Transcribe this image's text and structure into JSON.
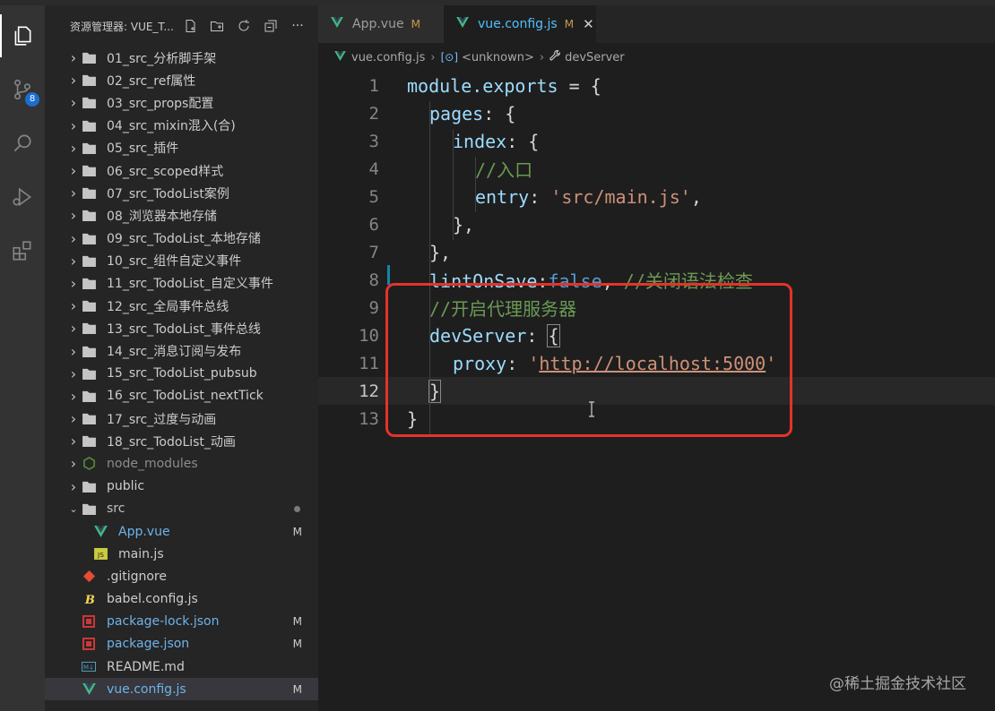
{
  "sidebar": {
    "title": "资源管理器: VUE_T...",
    "items": [
      {
        "name": "01_src_分析脚手架",
        "type": "folder",
        "expanded": false,
        "depth": 0
      },
      {
        "name": "02_src_ref属性",
        "type": "folder",
        "expanded": false,
        "depth": 0
      },
      {
        "name": "03_src_props配置",
        "type": "folder",
        "expanded": false,
        "depth": 0
      },
      {
        "name": "04_src_mixin混入(合)",
        "type": "folder",
        "expanded": false,
        "depth": 0
      },
      {
        "name": "05_src_插件",
        "type": "folder",
        "expanded": false,
        "depth": 0
      },
      {
        "name": "06_src_scoped样式",
        "type": "folder",
        "expanded": false,
        "depth": 0
      },
      {
        "name": "07_src_TodoList案例",
        "type": "folder",
        "expanded": false,
        "depth": 0
      },
      {
        "name": "08_浏览器本地存储",
        "type": "folder",
        "expanded": false,
        "depth": 0
      },
      {
        "name": "09_src_TodoList_本地存储",
        "type": "folder",
        "expanded": false,
        "depth": 0
      },
      {
        "name": "10_src_组件自定义事件",
        "type": "folder",
        "expanded": false,
        "depth": 0
      },
      {
        "name": "11_src_TodoList_自定义事件",
        "type": "folder",
        "expanded": false,
        "depth": 0
      },
      {
        "name": "12_src_全局事件总线",
        "type": "folder",
        "expanded": false,
        "depth": 0
      },
      {
        "name": "13_src_TodoList_事件总线",
        "type": "folder",
        "expanded": false,
        "depth": 0
      },
      {
        "name": "14_src_消息订阅与发布",
        "type": "folder",
        "expanded": false,
        "depth": 0
      },
      {
        "name": "15_src_TodoList_pubsub",
        "type": "folder",
        "expanded": false,
        "depth": 0
      },
      {
        "name": "16_src_TodoList_nextTick",
        "type": "folder",
        "expanded": false,
        "depth": 0
      },
      {
        "name": "17_src_过度与动画",
        "type": "folder",
        "expanded": false,
        "depth": 0
      },
      {
        "name": "18_src_TodoList_动画",
        "type": "folder",
        "expanded": false,
        "depth": 0
      },
      {
        "name": "node_modules",
        "type": "node-folder",
        "expanded": false,
        "depth": 0
      },
      {
        "name": "public",
        "type": "folder",
        "expanded": false,
        "depth": 0
      },
      {
        "name": "src",
        "type": "folder",
        "expanded": true,
        "depth": 0,
        "dot": true
      },
      {
        "name": "App.vue",
        "type": "vue",
        "depth": 1,
        "badge": "M"
      },
      {
        "name": "main.js",
        "type": "js",
        "depth": 1
      },
      {
        "name": ".gitignore",
        "type": "git",
        "depth": 0
      },
      {
        "name": "babel.config.js",
        "type": "babel",
        "depth": 0
      },
      {
        "name": "package-lock.json",
        "type": "npm",
        "depth": 0,
        "badge": "M"
      },
      {
        "name": "package.json",
        "type": "npm",
        "depth": 0,
        "badge": "M"
      },
      {
        "name": "README.md",
        "type": "md",
        "depth": 0
      },
      {
        "name": "vue.config.js",
        "type": "vue",
        "depth": 0,
        "badge": "M",
        "selected": true
      }
    ]
  },
  "activity": {
    "scm_badge": "8"
  },
  "tabs": [
    {
      "label": "App.vue",
      "mod": "M",
      "active": false
    },
    {
      "label": "vue.config.js",
      "mod": "M",
      "active": true,
      "close": "✕"
    }
  ],
  "breadcrumbs": [
    "vue.config.js",
    "<unknown>",
    "devServer"
  ],
  "code_lines": [
    {
      "n": "1"
    },
    {
      "n": "2"
    },
    {
      "n": "3"
    },
    {
      "n": "4"
    },
    {
      "n": "5"
    },
    {
      "n": "6"
    },
    {
      "n": "7"
    },
    {
      "n": "8"
    },
    {
      "n": "9"
    },
    {
      "n": "10"
    },
    {
      "n": "11"
    },
    {
      "n": "12"
    },
    {
      "n": "13"
    }
  ],
  "code": {
    "l1": [
      "module.exports",
      " = {"
    ],
    "l2": [
      "pages",
      ": {"
    ],
    "l3": [
      "index",
      ": {"
    ],
    "l4": "//入口",
    "l5": [
      "entry",
      ": ",
      "'src/main.js'",
      ","
    ],
    "l6": "},",
    "l7": "},",
    "l8": [
      "lintOnSave",
      ":",
      "false",
      ", ",
      "//关闭语法检查"
    ],
    "l9": "//开启代理服务器",
    "l10": [
      "devServer",
      ": ",
      "{"
    ],
    "l11": [
      "proxy",
      ": ",
      "'",
      "http://localhost:5000",
      "'"
    ],
    "l12": "}",
    "l13": "}"
  },
  "watermark": "@稀土掘金技术社区",
  "colors": {
    "highlight": "#e4332a",
    "vue_green": "#42b883",
    "accent": "#1c6dd0"
  }
}
